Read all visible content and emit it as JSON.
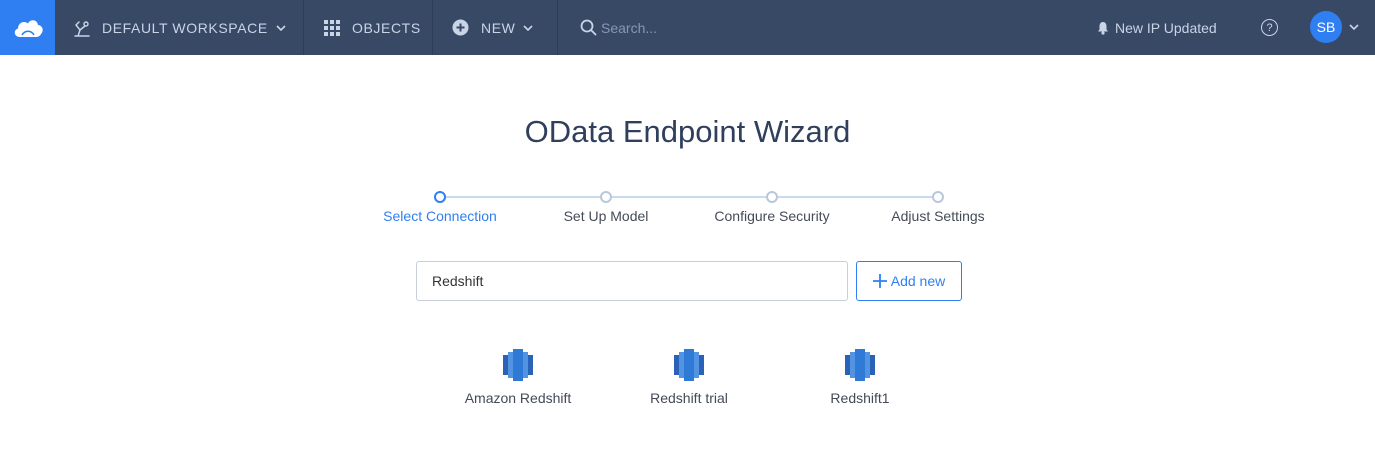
{
  "topbar": {
    "logo_icon": "cloud-icon",
    "workspace": {
      "icon": "workspace-icon",
      "label": "DEFAULT WORKSPACE"
    },
    "objects": {
      "icon": "grid-icon",
      "label": "OBJECTS"
    },
    "new": {
      "icon": "plus-circle-icon",
      "label": "NEW"
    },
    "search": {
      "icon": "search-icon",
      "placeholder": "Search..."
    },
    "notification": {
      "icon": "bell-icon",
      "label": "New IP Updated"
    },
    "help_icon": "help-icon",
    "user": {
      "initials": "SB"
    }
  },
  "wizard": {
    "title": "OData Endpoint Wizard",
    "steps": [
      {
        "label": "Select Connection",
        "active": true
      },
      {
        "label": "Set Up Model",
        "active": false
      },
      {
        "label": "Configure Security",
        "active": false
      },
      {
        "label": "Adjust Settings",
        "active": false
      }
    ],
    "search_value": "Redshift",
    "add_new_label": "Add new",
    "connections": [
      {
        "name": "Amazon Redshift",
        "icon": "redshift-icon"
      },
      {
        "name": "Redshift trial",
        "icon": "redshift-icon"
      },
      {
        "name": "Redshift1",
        "icon": "redshift-icon"
      }
    ]
  },
  "colors": {
    "topbar_bg": "#384966",
    "brand_blue": "#2f7ff2",
    "nav_text": "#c9d4e6",
    "title_text": "#2f3f5c"
  }
}
